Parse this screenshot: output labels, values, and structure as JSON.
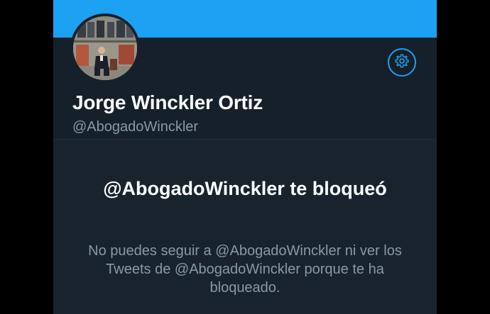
{
  "profile": {
    "display_name": "Jorge Winckler Ortiz",
    "handle": "@AbogadoWinckler",
    "settings_icon": "gear-icon"
  },
  "blocked": {
    "title": "@AbogadoWinckler te bloqueó",
    "message": "No puedes seguir a @AbogadoWinckler ni ver los Tweets de @AbogadoWinckler porque te ha bloqueado."
  },
  "colors": {
    "banner": "#1da1f2",
    "background": "#15202b",
    "accent": "#1da1f2",
    "secondary_text": "#8899a6"
  }
}
